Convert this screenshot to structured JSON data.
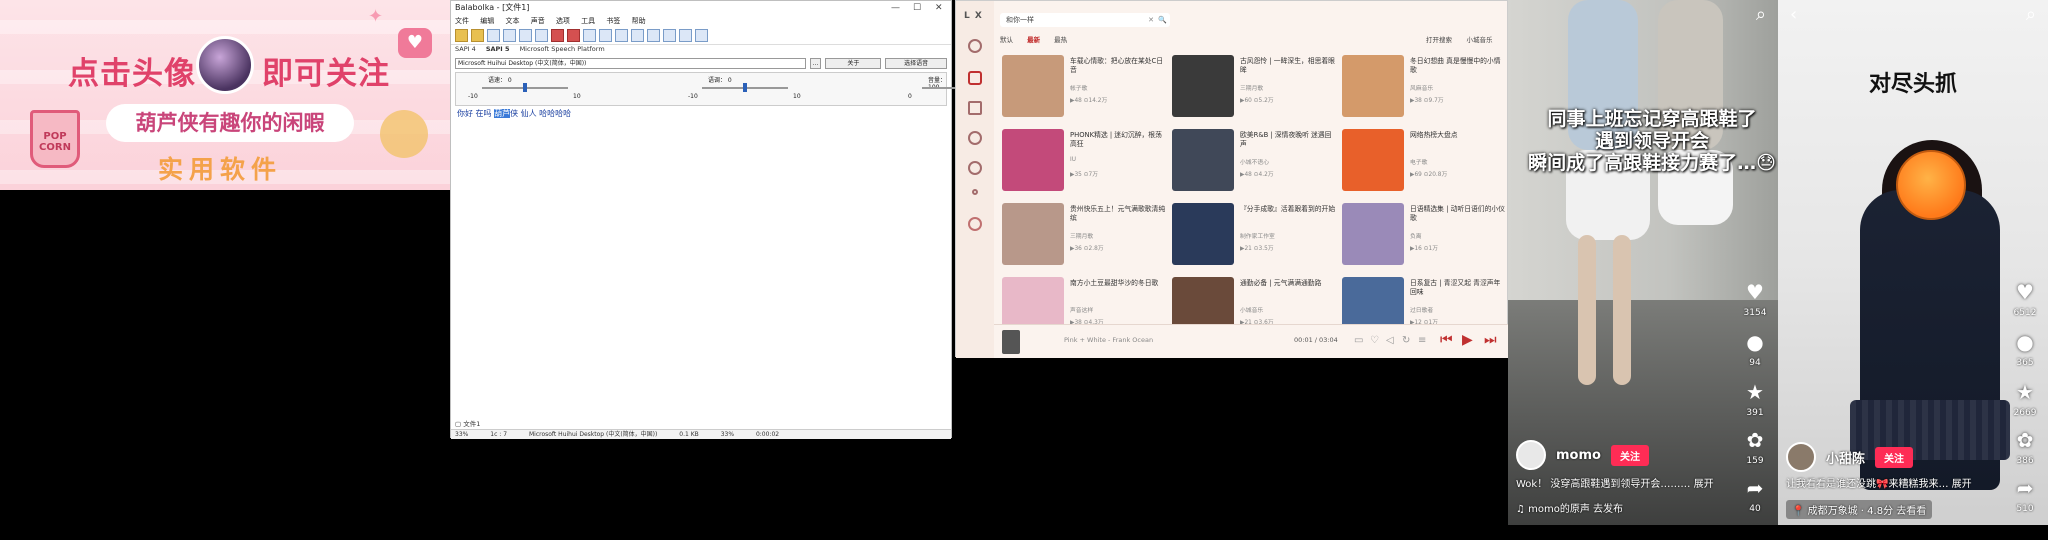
{
  "banner": {
    "line1a": "点击头像",
    "line1b": "即可关注",
    "pill": "葫芦侠有趣你的闲暇",
    "line3": "实用软件",
    "popcorn": "POP CORN"
  },
  "balabolka": {
    "title": "Balabolka - [文件1]",
    "window_controls": [
      "—",
      "☐",
      "✕"
    ],
    "menu": [
      "文件",
      "编辑",
      "文本",
      "声音",
      "选项",
      "工具",
      "书签",
      "帮助"
    ],
    "sapi_tabs": [
      "SAPI 4",
      "SAPI 5",
      "Microsoft Speech Platform"
    ],
    "voice": "Microsoft Huihui Desktop (中文(简体，中国))",
    "about_button": "关于",
    "select_button": "选择语音",
    "sliders": [
      {
        "label": "语速：",
        "value": "0",
        "min": "-10",
        "max": "10",
        "level": 0.5
      },
      {
        "label": "语调：",
        "value": "0",
        "min": "-10",
        "max": "10",
        "level": 0.5
      },
      {
        "label": "音量：",
        "value": "100",
        "min": "0",
        "max": "100",
        "level": 1.0
      }
    ],
    "text_before": "你好 在吗 ",
    "text_highlight": "葫芦",
    "text_after": "侠 仙人 哈哈哈哈",
    "doc_tab": "文件1",
    "status": [
      "33%",
      "1c : 7",
      "Microsoft Huihui Desktop (中文(简体，中国))",
      "0.1 KB",
      "33%",
      "0:00:02"
    ]
  },
  "music": {
    "logo": "L X",
    "search_value": "和你一样",
    "search_clear": "✕",
    "search_go": "🔍",
    "tabs": [
      "默认",
      "最新",
      "最热"
    ],
    "active_tab": "最新",
    "top_right": [
      "打开搜索",
      "小城音乐"
    ],
    "cards": [
      {
        "title": "车载心情歌：把心放在某处C日音",
        "author": "帐子歌",
        "meta": "▶48  ⊙14.2万",
        "color": "#c79a7a"
      },
      {
        "title": "古风怨怜 | 一眸深生，相思着眼眸",
        "author": "三期月歌",
        "meta": "▶60  ⊙5.2万",
        "color": "#3a3a3a"
      },
      {
        "title": "冬日幻想曲 真是慢慢中的小情歌",
        "author": "风麻音乐",
        "meta": "▶38  ⊙9.7万",
        "color": "#d49a6a"
      },
      {
        "title": "PHONK精选 | 迷幻沉醉，根荡高狂",
        "author": "IU",
        "meta": "▶35  ⊙7万",
        "color": "#c34a7a"
      },
      {
        "title": "欧美R&B | 深情夜晚听 迷遇回声",
        "author": "小城不语心",
        "meta": "▶48  ⊙4.2万",
        "color": "#404858"
      },
      {
        "title": "网络热榜大盘点",
        "author": "电子歌",
        "meta": "▶69  ⊙20.8万",
        "color": "#e8602a"
      },
      {
        "title": "贵州快乐五上！元气满歌歌清纯缤",
        "author": "三期月歌",
        "meta": "▶36  ⊙2.8万",
        "color": "#b8988a"
      },
      {
        "title": "『分手成歌』活着跟着到的开始",
        "author": "制作家工作室",
        "meta": "▶21  ⊙3.5万",
        "color": "#2a3a5a"
      },
      {
        "title": "日语精选集 | 动听日语们的小仪歌",
        "author": "负离",
        "meta": "▶16  ⊙1万",
        "color": "#9a8ab8"
      },
      {
        "title": "南方小土豆最甜华沙的冬日歌",
        "author": "声音这样",
        "meta": "▶38  ⊙4.3万",
        "color": "#e8b8c8"
      },
      {
        "title": "通勤必备 | 元气满满通勤路",
        "author": "小城音乐",
        "meta": "▶21  ⊙3.6万",
        "color": "#6a4a3a"
      },
      {
        "title": "日系复古 | 青涩又起 青涩声年回味",
        "author": "过日歌者",
        "meta": "▶12  ⊙1万",
        "color": "#4a6a9a"
      }
    ],
    "now_playing": "Pink + White - Frank Ocean",
    "time": "00:01 / 03:04"
  },
  "video1": {
    "caption": "同事上班忘记穿高跟鞋了遇到领导开会瞬间成了高跟鞋接力赛了…😓",
    "caption_lines": [
      "同事上班忘记穿高跟鞋了",
      "遇到领导开会",
      "瞬间成了高跟鞋接力赛了…😓"
    ],
    "counts": [
      "3154",
      "94",
      "391",
      "159",
      "40"
    ],
    "user": "momo",
    "follow": "关注",
    "desc": "Wok！ 没穿高跟鞋遇到领导开会……… 展开",
    "music": "♫ momo的原声   去发布"
  },
  "video2": {
    "title": "对尽头抓",
    "counts": [
      "6512",
      "365",
      "2669",
      "386",
      "510"
    ],
    "user": "小甜陈",
    "follow": "关注",
    "desc": "让我看看是谁还没跳🎀来糟糕我来… 展开",
    "location": "📍 成都万象城 · 4.8分   去看看"
  }
}
